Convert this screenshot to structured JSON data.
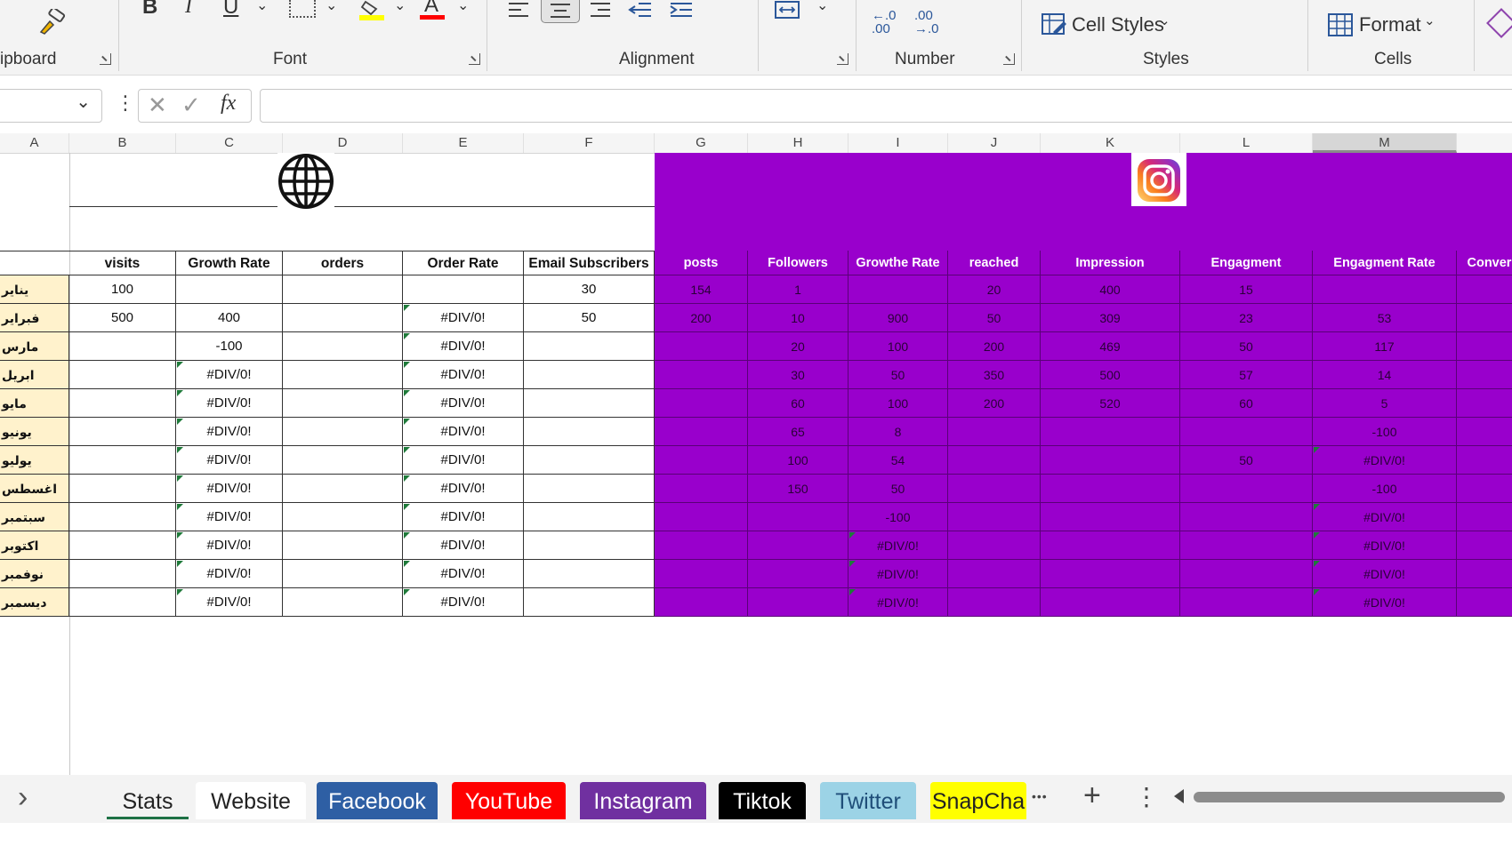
{
  "ribbon": {
    "groups": {
      "clipboard": "ipboard",
      "font": "Font",
      "alignment": "Alignment",
      "number": "Number",
      "styles": "Styles",
      "cells": "Cells"
    },
    "font_buttons": {
      "bold": "B",
      "italic": "I",
      "underline": "U",
      "font_color": "A"
    },
    "number_buttons": {
      "increase_decimal": "←.0 .00",
      "decrease_decimal": ".00 →.0"
    },
    "cell_styles_label": "Cell Styles",
    "format_label": "Format",
    "colors": {
      "highlight": "#ffff00",
      "font_color": "#ff0000"
    }
  },
  "formula_bar": {
    "fx_label": "fx",
    "value": ""
  },
  "columns": [
    "A",
    "B",
    "C",
    "D",
    "E",
    "F",
    "G",
    "H",
    "I",
    "J",
    "K",
    "L",
    "M"
  ],
  "selected_column": "M",
  "website_headers": [
    "visits",
    "Growth Rate",
    "orders",
    "Order Rate",
    "Email Subscribers"
  ],
  "instagram_headers": [
    "posts",
    "Followers",
    "Growthe Rate",
    "reached",
    "Impression",
    "Engagment",
    "Engagment Rate",
    "Convers"
  ],
  "months": [
    "يناير",
    "فبراير",
    "مارس",
    "ابريل",
    "مايو",
    "يونيو",
    "يوليو",
    "اغسطس",
    "سبتمبر",
    "اكتوبر",
    "نوفمبر",
    "ديسمبر"
  ],
  "website_rows": [
    [
      "100",
      "",
      "",
      "",
      "30"
    ],
    [
      "500",
      "400",
      "",
      "#DIV/0!",
      "50"
    ],
    [
      "",
      "-100",
      "",
      "#DIV/0!",
      ""
    ],
    [
      "",
      "#DIV/0!",
      "",
      "#DIV/0!",
      ""
    ],
    [
      "",
      "#DIV/0!",
      "",
      "#DIV/0!",
      ""
    ],
    [
      "",
      "#DIV/0!",
      "",
      "#DIV/0!",
      ""
    ],
    [
      "",
      "#DIV/0!",
      "",
      "#DIV/0!",
      ""
    ],
    [
      "",
      "#DIV/0!",
      "",
      "#DIV/0!",
      ""
    ],
    [
      "",
      "#DIV/0!",
      "",
      "#DIV/0!",
      ""
    ],
    [
      "",
      "#DIV/0!",
      "",
      "#DIV/0!",
      ""
    ],
    [
      "",
      "#DIV/0!",
      "",
      "#DIV/0!",
      ""
    ],
    [
      "",
      "#DIV/0!",
      "",
      "#DIV/0!",
      ""
    ]
  ],
  "instagram_rows": [
    [
      "154",
      "1",
      "",
      "20",
      "400",
      "15",
      "",
      ""
    ],
    [
      "200",
      "10",
      "900",
      "50",
      "309",
      "23",
      "53",
      ""
    ],
    [
      "",
      "20",
      "100",
      "200",
      "469",
      "50",
      "117",
      ""
    ],
    [
      "",
      "30",
      "50",
      "350",
      "500",
      "57",
      "14",
      ""
    ],
    [
      "",
      "60",
      "100",
      "200",
      "520",
      "60",
      "5",
      ""
    ],
    [
      "",
      "65",
      "8",
      "",
      "",
      "",
      "-100",
      ""
    ],
    [
      "",
      "100",
      "54",
      "",
      "",
      "50",
      "#DIV/0!",
      ""
    ],
    [
      "",
      "150",
      "50",
      "",
      "",
      "",
      "-100",
      ""
    ],
    [
      "",
      "",
      "-100",
      "",
      "",
      "",
      "#DIV/0!",
      ""
    ],
    [
      "",
      "",
      "#DIV/0!",
      "",
      "",
      "",
      "#DIV/0!",
      ""
    ],
    [
      "",
      "",
      "#DIV/0!",
      "",
      "",
      "",
      "#DIV/0!",
      ""
    ],
    [
      "",
      "",
      "#DIV/0!",
      "",
      "",
      "",
      "#DIV/0!",
      ""
    ]
  ],
  "colors": {
    "instagram_fill": "#9900cc",
    "month_fill": "#fff2cc",
    "error_marker": "#1f7a3a"
  },
  "sheet_tabs": [
    {
      "label": "Stats",
      "bg": "#f3f3f3",
      "fg": "#222",
      "active": true
    },
    {
      "label": "Website",
      "bg": "#ffffff",
      "fg": "#222"
    },
    {
      "label": "Facebook",
      "bg": "#2e5fa4",
      "fg": "#ffffff"
    },
    {
      "label": "YouTube",
      "bg": "#ff0000",
      "fg": "#ffffff"
    },
    {
      "label": "Instagram",
      "bg": "#7030a0",
      "fg": "#ffffff"
    },
    {
      "label": "Tiktok",
      "bg": "#000000",
      "fg": "#ffffff"
    },
    {
      "label": "Twitter",
      "bg": "#9cd3e6",
      "fg": "#1f4e79"
    },
    {
      "label": "SnapCha",
      "bg": "#ffff00",
      "fg": "#222"
    }
  ],
  "tab_controls": {
    "more": "•••",
    "add": "+",
    "options": "⋮",
    "nav": "›"
  }
}
